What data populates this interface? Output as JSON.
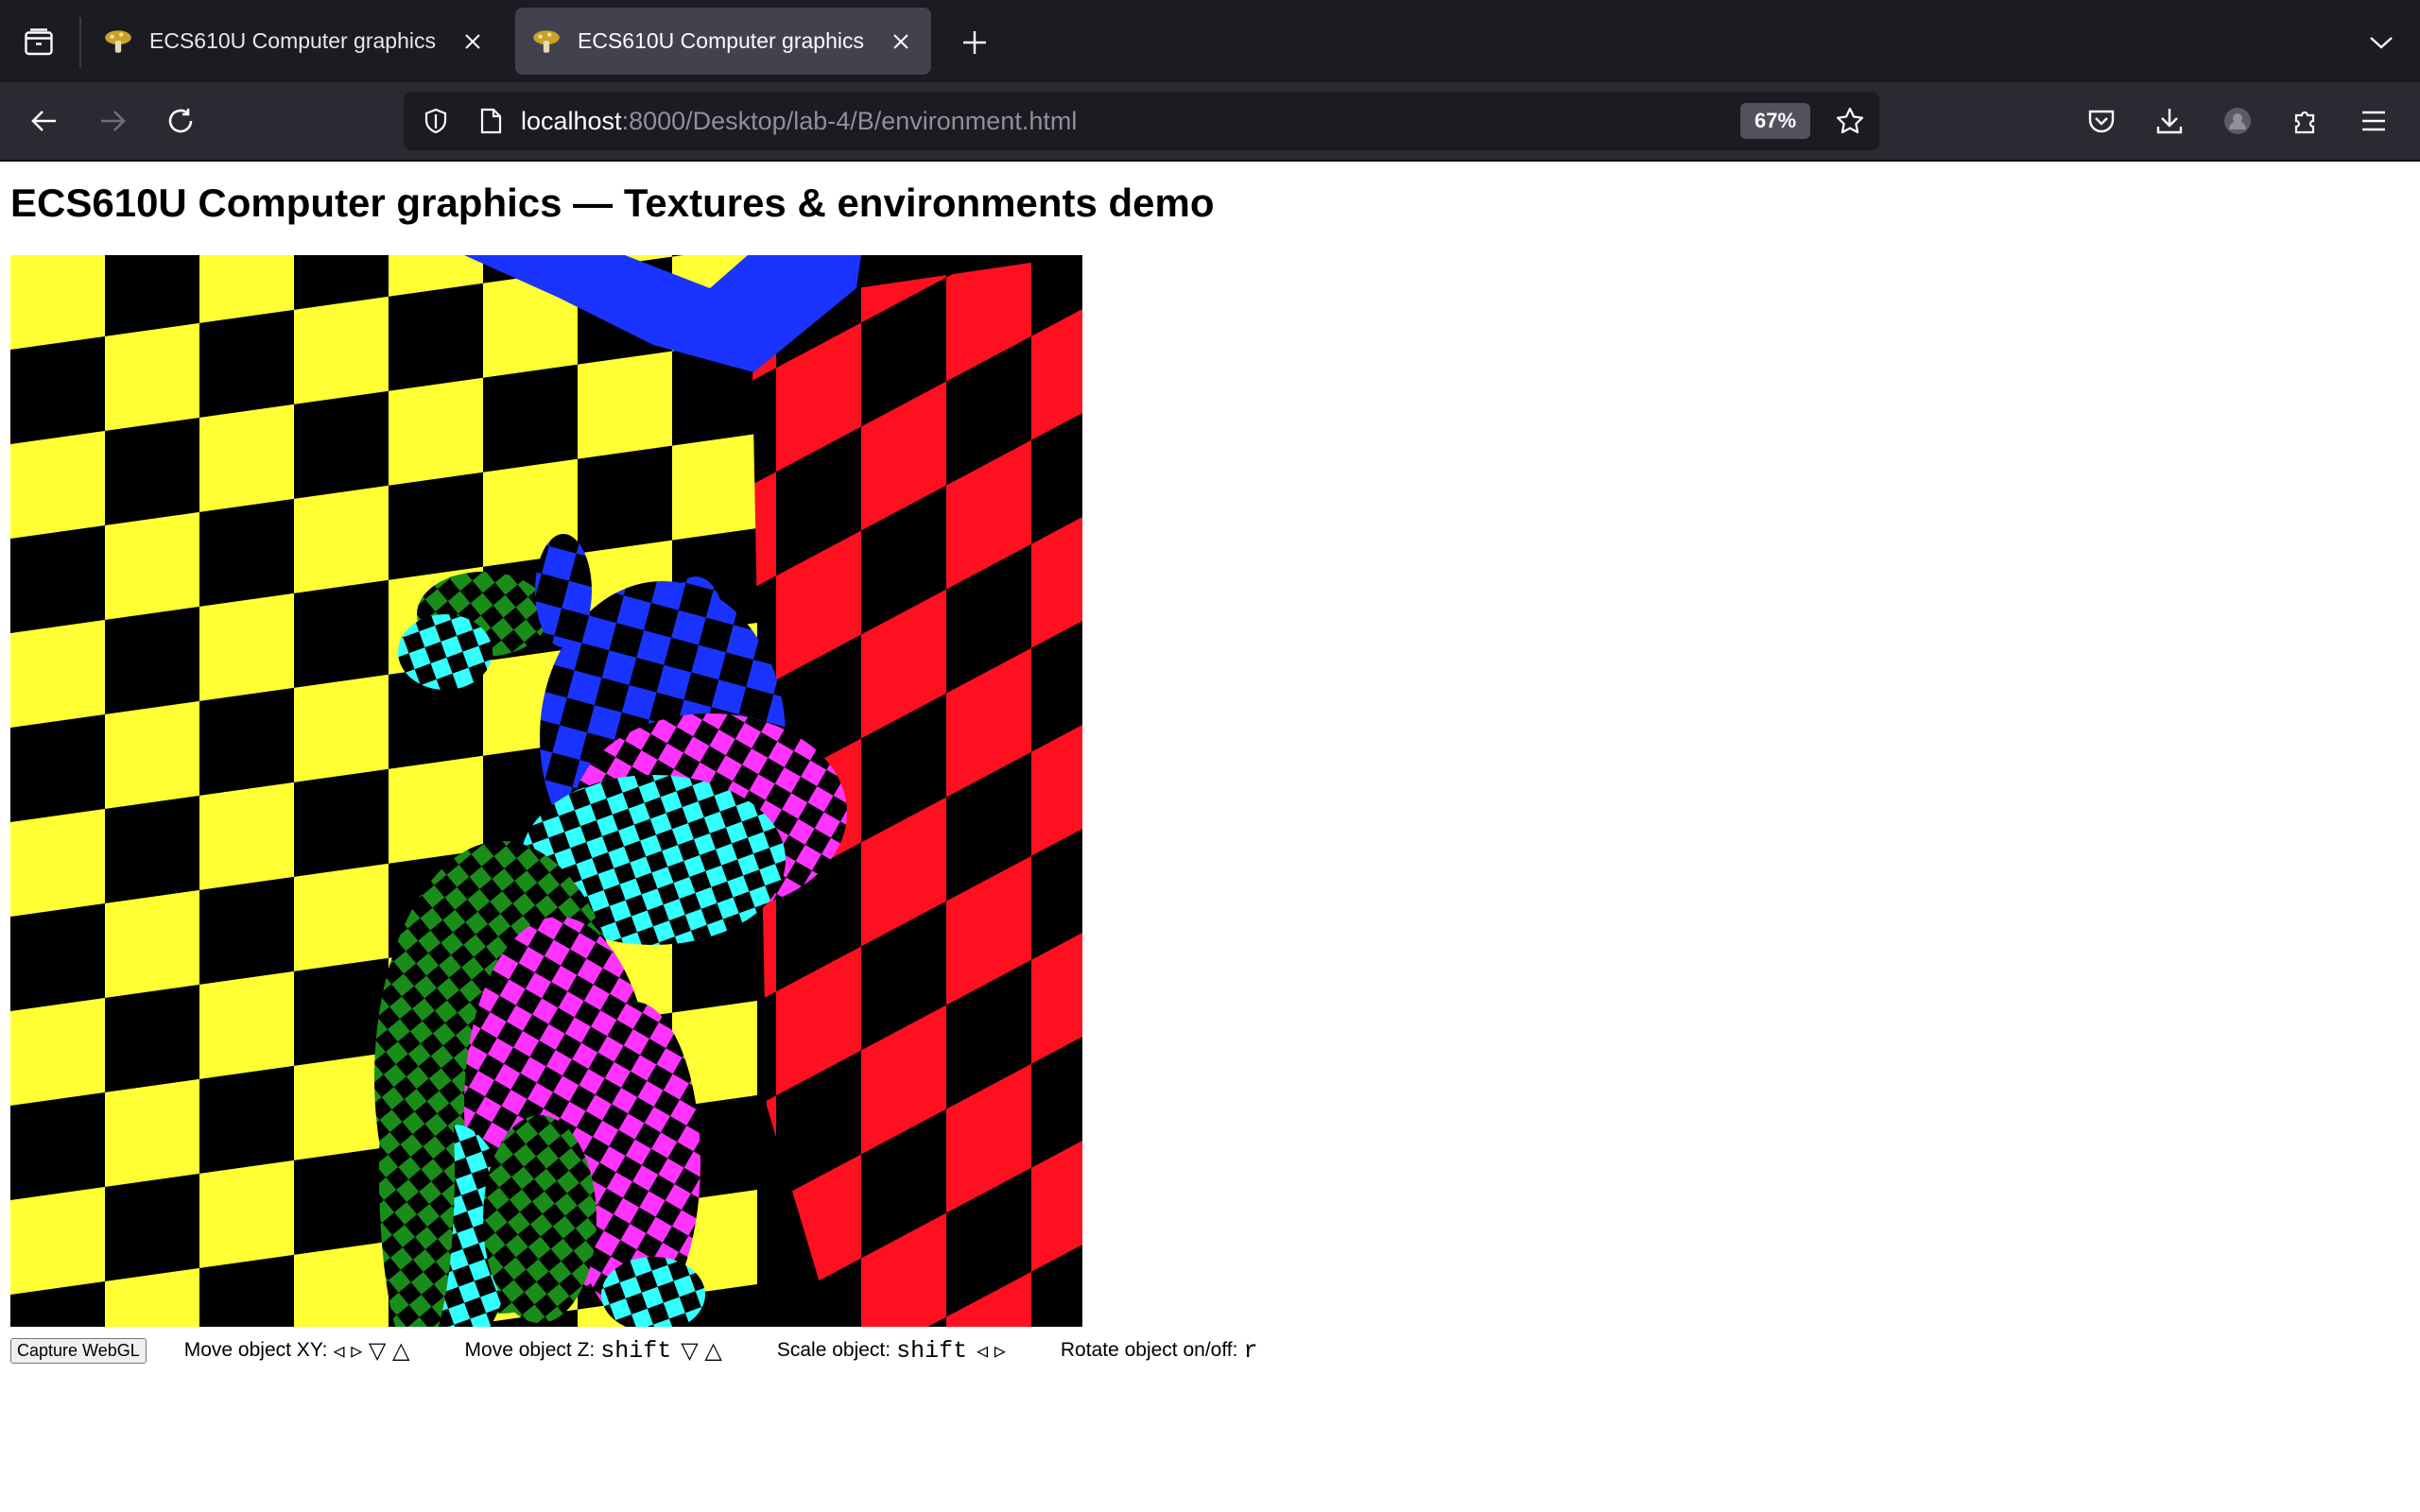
{
  "browser": {
    "tabs": [
      {
        "title": "ECS610U Computer graphics",
        "active": false
      },
      {
        "title": "ECS610U Computer graphics",
        "active": true
      }
    ],
    "url": {
      "host": "localhost",
      "rest": ":8000/Desktop/lab-4/B/environment.html"
    },
    "zoom": "67%"
  },
  "page": {
    "title": "ECS610U Computer graphics — Textures & environments demo",
    "capture_button": "Capture WebGL",
    "controls": [
      {
        "label": "Move object XY:",
        "key": "",
        "arrows": "◃ ▹ ▽ △"
      },
      {
        "label": "Move object Z:",
        "key": "shift",
        "arrows": "▽ △"
      },
      {
        "label": "Scale object:",
        "key": "shift",
        "arrows": "◃ ▹"
      },
      {
        "label": "Rotate object on/off:",
        "key": "r",
        "arrows": ""
      }
    ]
  },
  "colors": {
    "checker_yellow": "#ffff33",
    "checker_red": "#ff1020",
    "checker_blue": "#1a33ff",
    "model_magenta": "#ff33ff",
    "model_cyan": "#33ffff",
    "model_green": "#1a8c1a"
  }
}
